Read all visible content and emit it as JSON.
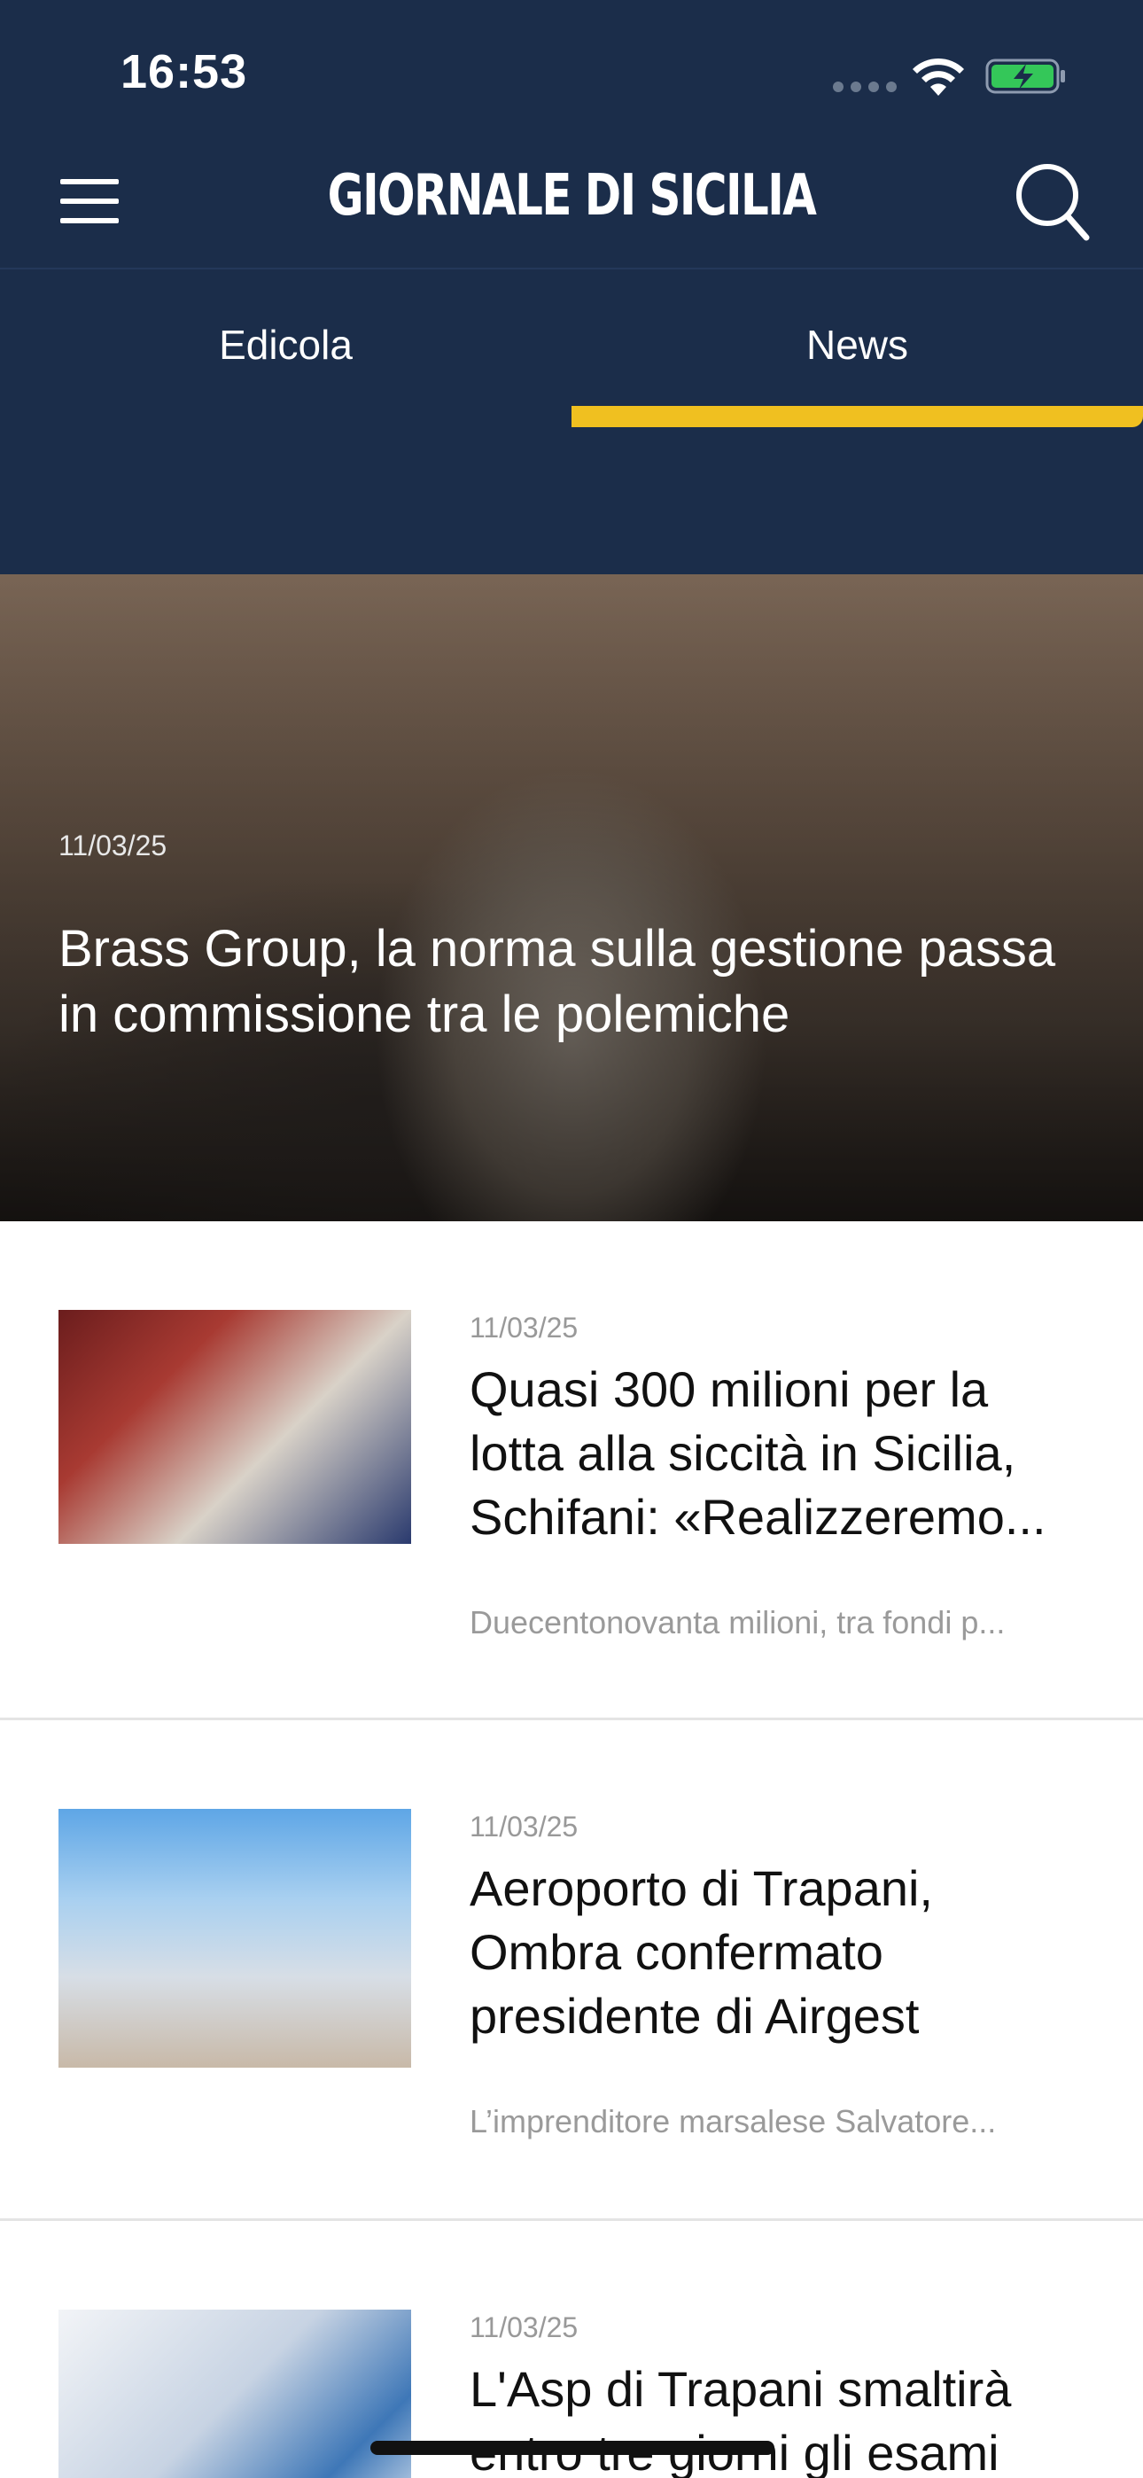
{
  "status_bar": {
    "time": "16:53"
  },
  "header": {
    "brand": "GIORNALE DI SICILIA"
  },
  "tabs": [
    {
      "label": "Edicola",
      "selected": false
    },
    {
      "label": "News",
      "selected": true
    }
  ],
  "colors": {
    "header_bg": "#1b2d4a",
    "tab_indicator": "#f0c020",
    "battery": "#34c759"
  },
  "hero": {
    "date": "11/03/25",
    "title": "Brass Group, la norma sulla gestione passa in commissione tra le polemiche"
  },
  "articles": [
    {
      "date": "11/03/25",
      "title": "Quasi 300 milioni per la lotta alla siccità in Sicilia, Schifani: «Realizzeremo...",
      "summary": "Duecentonovanta milioni, tra fondi p..."
    },
    {
      "date": "11/03/25",
      "title": "Aeroporto di Trapani, Ombra confermato presidente di Airgest",
      "summary": "L’imprenditore marsalese Salvatore..."
    },
    {
      "date": "11/03/25",
      "title": "L'Asp di Trapani smaltirà entro tre giorni gli esami",
      "summary": ""
    }
  ]
}
